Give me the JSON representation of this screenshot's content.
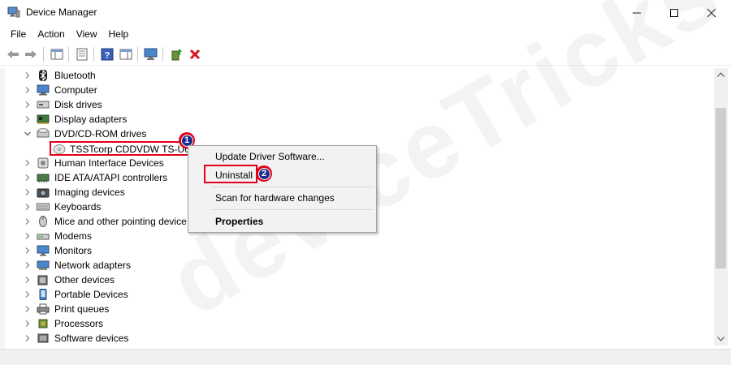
{
  "window": {
    "title": "Device Manager",
    "controls": {
      "minimize": "minimize-icon",
      "maximize": "maximize-icon",
      "close": "close-icon"
    }
  },
  "menu": [
    "File",
    "Action",
    "View",
    "Help"
  ],
  "toolbar": {
    "buttons": [
      "back-arrow-icon",
      "forward-arrow-icon",
      "show-hide-console-tree-icon",
      "properties-icon",
      "help-icon",
      "action-pane-icon",
      "scan-hardware-icon",
      "update-driver-icon",
      "uninstall-x-icon"
    ]
  },
  "tree": {
    "items": [
      {
        "label": "Bluetooth",
        "icon": "bluetooth-icon",
        "expanded": false
      },
      {
        "label": "Computer",
        "icon": "computer-icon",
        "expanded": false
      },
      {
        "label": "Disk drives",
        "icon": "disk-drive-icon",
        "expanded": false
      },
      {
        "label": "Display adapters",
        "icon": "display-adapter-icon",
        "expanded": false
      },
      {
        "label": "DVD/CD-ROM drives",
        "icon": "dvd-drive-icon",
        "expanded": true
      },
      {
        "label": "TSSTcorp CDDVDW TS-U63",
        "icon": "disc-icon",
        "child": true,
        "selected": true
      },
      {
        "label": "Human Interface Devices",
        "icon": "hid-icon",
        "expanded": false
      },
      {
        "label": "IDE ATA/ATAPI controllers",
        "icon": "ide-controller-icon",
        "expanded": false
      },
      {
        "label": "Imaging devices",
        "icon": "camera-icon",
        "expanded": false
      },
      {
        "label": "Keyboards",
        "icon": "keyboard-icon",
        "expanded": false
      },
      {
        "label": "Mice and other pointing device",
        "icon": "mouse-icon",
        "expanded": false
      },
      {
        "label": "Modems",
        "icon": "modem-icon",
        "expanded": false
      },
      {
        "label": "Monitors",
        "icon": "monitor-icon",
        "expanded": false
      },
      {
        "label": "Network adapters",
        "icon": "network-adapter-icon",
        "expanded": false
      },
      {
        "label": "Other devices",
        "icon": "other-devices-icon",
        "expanded": false
      },
      {
        "label": "Portable Devices",
        "icon": "portable-device-icon",
        "expanded": false
      },
      {
        "label": "Print queues",
        "icon": "printer-icon",
        "expanded": false
      },
      {
        "label": "Processors",
        "icon": "processor-icon",
        "expanded": false
      },
      {
        "label": "Software devices",
        "icon": "software-device-icon",
        "expanded": false
      }
    ]
  },
  "context_menu": {
    "items": [
      {
        "label": "Update Driver Software...",
        "bold": false
      },
      {
        "label": "Uninstall",
        "bold": false,
        "highlighted": true
      },
      {
        "label": "Scan for hardware changes",
        "bold": false
      },
      {
        "label": "Properties",
        "bold": true
      }
    ]
  },
  "annotations": {
    "step1": "1",
    "step2": "2"
  },
  "watermark": "deviceTricks",
  "colors": {
    "highlight_red": "#e3001b",
    "badge_blue": "#1a2d8c",
    "menu_bg": "#f2f2f2"
  }
}
